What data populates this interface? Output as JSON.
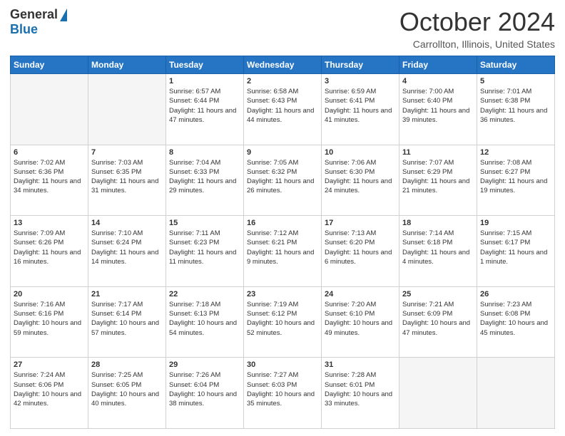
{
  "header": {
    "logo_general": "General",
    "logo_blue": "Blue",
    "month": "October 2024",
    "location": "Carrollton, Illinois, United States"
  },
  "days_of_week": [
    "Sunday",
    "Monday",
    "Tuesday",
    "Wednesday",
    "Thursday",
    "Friday",
    "Saturday"
  ],
  "weeks": [
    [
      {
        "num": "",
        "empty": true
      },
      {
        "num": "",
        "empty": true
      },
      {
        "num": "1",
        "sunrise": "Sunrise: 6:57 AM",
        "sunset": "Sunset: 6:44 PM",
        "daylight": "Daylight: 11 hours and 47 minutes."
      },
      {
        "num": "2",
        "sunrise": "Sunrise: 6:58 AM",
        "sunset": "Sunset: 6:43 PM",
        "daylight": "Daylight: 11 hours and 44 minutes."
      },
      {
        "num": "3",
        "sunrise": "Sunrise: 6:59 AM",
        "sunset": "Sunset: 6:41 PM",
        "daylight": "Daylight: 11 hours and 41 minutes."
      },
      {
        "num": "4",
        "sunrise": "Sunrise: 7:00 AM",
        "sunset": "Sunset: 6:40 PM",
        "daylight": "Daylight: 11 hours and 39 minutes."
      },
      {
        "num": "5",
        "sunrise": "Sunrise: 7:01 AM",
        "sunset": "Sunset: 6:38 PM",
        "daylight": "Daylight: 11 hours and 36 minutes."
      }
    ],
    [
      {
        "num": "6",
        "sunrise": "Sunrise: 7:02 AM",
        "sunset": "Sunset: 6:36 PM",
        "daylight": "Daylight: 11 hours and 34 minutes."
      },
      {
        "num": "7",
        "sunrise": "Sunrise: 7:03 AM",
        "sunset": "Sunset: 6:35 PM",
        "daylight": "Daylight: 11 hours and 31 minutes."
      },
      {
        "num": "8",
        "sunrise": "Sunrise: 7:04 AM",
        "sunset": "Sunset: 6:33 PM",
        "daylight": "Daylight: 11 hours and 29 minutes."
      },
      {
        "num": "9",
        "sunrise": "Sunrise: 7:05 AM",
        "sunset": "Sunset: 6:32 PM",
        "daylight": "Daylight: 11 hours and 26 minutes."
      },
      {
        "num": "10",
        "sunrise": "Sunrise: 7:06 AM",
        "sunset": "Sunset: 6:30 PM",
        "daylight": "Daylight: 11 hours and 24 minutes."
      },
      {
        "num": "11",
        "sunrise": "Sunrise: 7:07 AM",
        "sunset": "Sunset: 6:29 PM",
        "daylight": "Daylight: 11 hours and 21 minutes."
      },
      {
        "num": "12",
        "sunrise": "Sunrise: 7:08 AM",
        "sunset": "Sunset: 6:27 PM",
        "daylight": "Daylight: 11 hours and 19 minutes."
      }
    ],
    [
      {
        "num": "13",
        "sunrise": "Sunrise: 7:09 AM",
        "sunset": "Sunset: 6:26 PM",
        "daylight": "Daylight: 11 hours and 16 minutes."
      },
      {
        "num": "14",
        "sunrise": "Sunrise: 7:10 AM",
        "sunset": "Sunset: 6:24 PM",
        "daylight": "Daylight: 11 hours and 14 minutes."
      },
      {
        "num": "15",
        "sunrise": "Sunrise: 7:11 AM",
        "sunset": "Sunset: 6:23 PM",
        "daylight": "Daylight: 11 hours and 11 minutes."
      },
      {
        "num": "16",
        "sunrise": "Sunrise: 7:12 AM",
        "sunset": "Sunset: 6:21 PM",
        "daylight": "Daylight: 11 hours and 9 minutes."
      },
      {
        "num": "17",
        "sunrise": "Sunrise: 7:13 AM",
        "sunset": "Sunset: 6:20 PM",
        "daylight": "Daylight: 11 hours and 6 minutes."
      },
      {
        "num": "18",
        "sunrise": "Sunrise: 7:14 AM",
        "sunset": "Sunset: 6:18 PM",
        "daylight": "Daylight: 11 hours and 4 minutes."
      },
      {
        "num": "19",
        "sunrise": "Sunrise: 7:15 AM",
        "sunset": "Sunset: 6:17 PM",
        "daylight": "Daylight: 11 hours and 1 minute."
      }
    ],
    [
      {
        "num": "20",
        "sunrise": "Sunrise: 7:16 AM",
        "sunset": "Sunset: 6:16 PM",
        "daylight": "Daylight: 10 hours and 59 minutes."
      },
      {
        "num": "21",
        "sunrise": "Sunrise: 7:17 AM",
        "sunset": "Sunset: 6:14 PM",
        "daylight": "Daylight: 10 hours and 57 minutes."
      },
      {
        "num": "22",
        "sunrise": "Sunrise: 7:18 AM",
        "sunset": "Sunset: 6:13 PM",
        "daylight": "Daylight: 10 hours and 54 minutes."
      },
      {
        "num": "23",
        "sunrise": "Sunrise: 7:19 AM",
        "sunset": "Sunset: 6:12 PM",
        "daylight": "Daylight: 10 hours and 52 minutes."
      },
      {
        "num": "24",
        "sunrise": "Sunrise: 7:20 AM",
        "sunset": "Sunset: 6:10 PM",
        "daylight": "Daylight: 10 hours and 49 minutes."
      },
      {
        "num": "25",
        "sunrise": "Sunrise: 7:21 AM",
        "sunset": "Sunset: 6:09 PM",
        "daylight": "Daylight: 10 hours and 47 minutes."
      },
      {
        "num": "26",
        "sunrise": "Sunrise: 7:23 AM",
        "sunset": "Sunset: 6:08 PM",
        "daylight": "Daylight: 10 hours and 45 minutes."
      }
    ],
    [
      {
        "num": "27",
        "sunrise": "Sunrise: 7:24 AM",
        "sunset": "Sunset: 6:06 PM",
        "daylight": "Daylight: 10 hours and 42 minutes."
      },
      {
        "num": "28",
        "sunrise": "Sunrise: 7:25 AM",
        "sunset": "Sunset: 6:05 PM",
        "daylight": "Daylight: 10 hours and 40 minutes."
      },
      {
        "num": "29",
        "sunrise": "Sunrise: 7:26 AM",
        "sunset": "Sunset: 6:04 PM",
        "daylight": "Daylight: 10 hours and 38 minutes."
      },
      {
        "num": "30",
        "sunrise": "Sunrise: 7:27 AM",
        "sunset": "Sunset: 6:03 PM",
        "daylight": "Daylight: 10 hours and 35 minutes."
      },
      {
        "num": "31",
        "sunrise": "Sunrise: 7:28 AM",
        "sunset": "Sunset: 6:01 PM",
        "daylight": "Daylight: 10 hours and 33 minutes."
      },
      {
        "num": "",
        "empty": true
      },
      {
        "num": "",
        "empty": true
      }
    ]
  ]
}
